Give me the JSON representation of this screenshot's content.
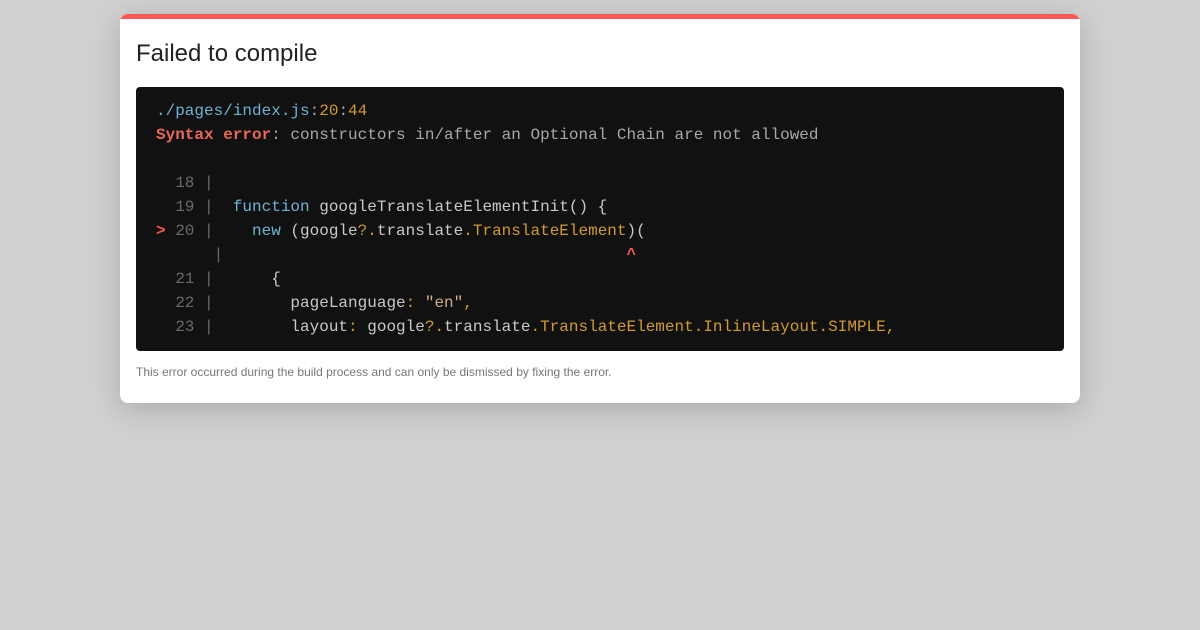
{
  "dialog": {
    "title": "Failed to compile",
    "footer": "This error occurred during the build process and can only be dismissed by fixing the error.",
    "accent_color": "#ff5555"
  },
  "error": {
    "file_path": "./pages/index.js",
    "sep1": ":",
    "line": "20",
    "sep2": ":",
    "column": "44",
    "label": "Syntax error",
    "message": ": constructors in/after an Optional Chain are not allowed"
  },
  "code": {
    "l18": {
      "marker": "  ",
      "num": "18",
      "pipe": " |"
    },
    "l19": {
      "marker": "  ",
      "num": "19",
      "pipe": " |",
      "indent": "  ",
      "kw": "function",
      "rest": " googleTranslateElementInit() {"
    },
    "l20": {
      "marker": "> ",
      "num": "20",
      "pipe": " |",
      "indent": "    ",
      "kw": "new",
      "p1": " (google",
      "opt1": "?.",
      "p2": "translate",
      "dot1": ".",
      "type1": "TranslateElement",
      "p3": ")("
    },
    "caret_line": {
      "pad": "     ",
      "pipe": " |",
      "space": "                                          ",
      "caret": "^"
    },
    "l21": {
      "marker": "  ",
      "num": "21",
      "pipe": " |",
      "indent": "      ",
      "text": "{"
    },
    "l22": {
      "marker": "  ",
      "num": "22",
      "pipe": " |",
      "indent": "        ",
      "key": "pageLanguage",
      "colon": ": ",
      "str": "\"en\"",
      "comma": ","
    },
    "l23": {
      "marker": "  ",
      "num": "23",
      "pipe": " |",
      "indent": "        ",
      "key": "layout",
      "colon": ": ",
      "p1": "google",
      "opt1": "?.",
      "p2": "translate",
      "dot1": ".",
      "type1": "TranslateElement",
      "dot2": ".",
      "type2": "InlineLayout",
      "dot3": ".",
      "type3": "SIMPLE",
      "comma": ","
    }
  }
}
